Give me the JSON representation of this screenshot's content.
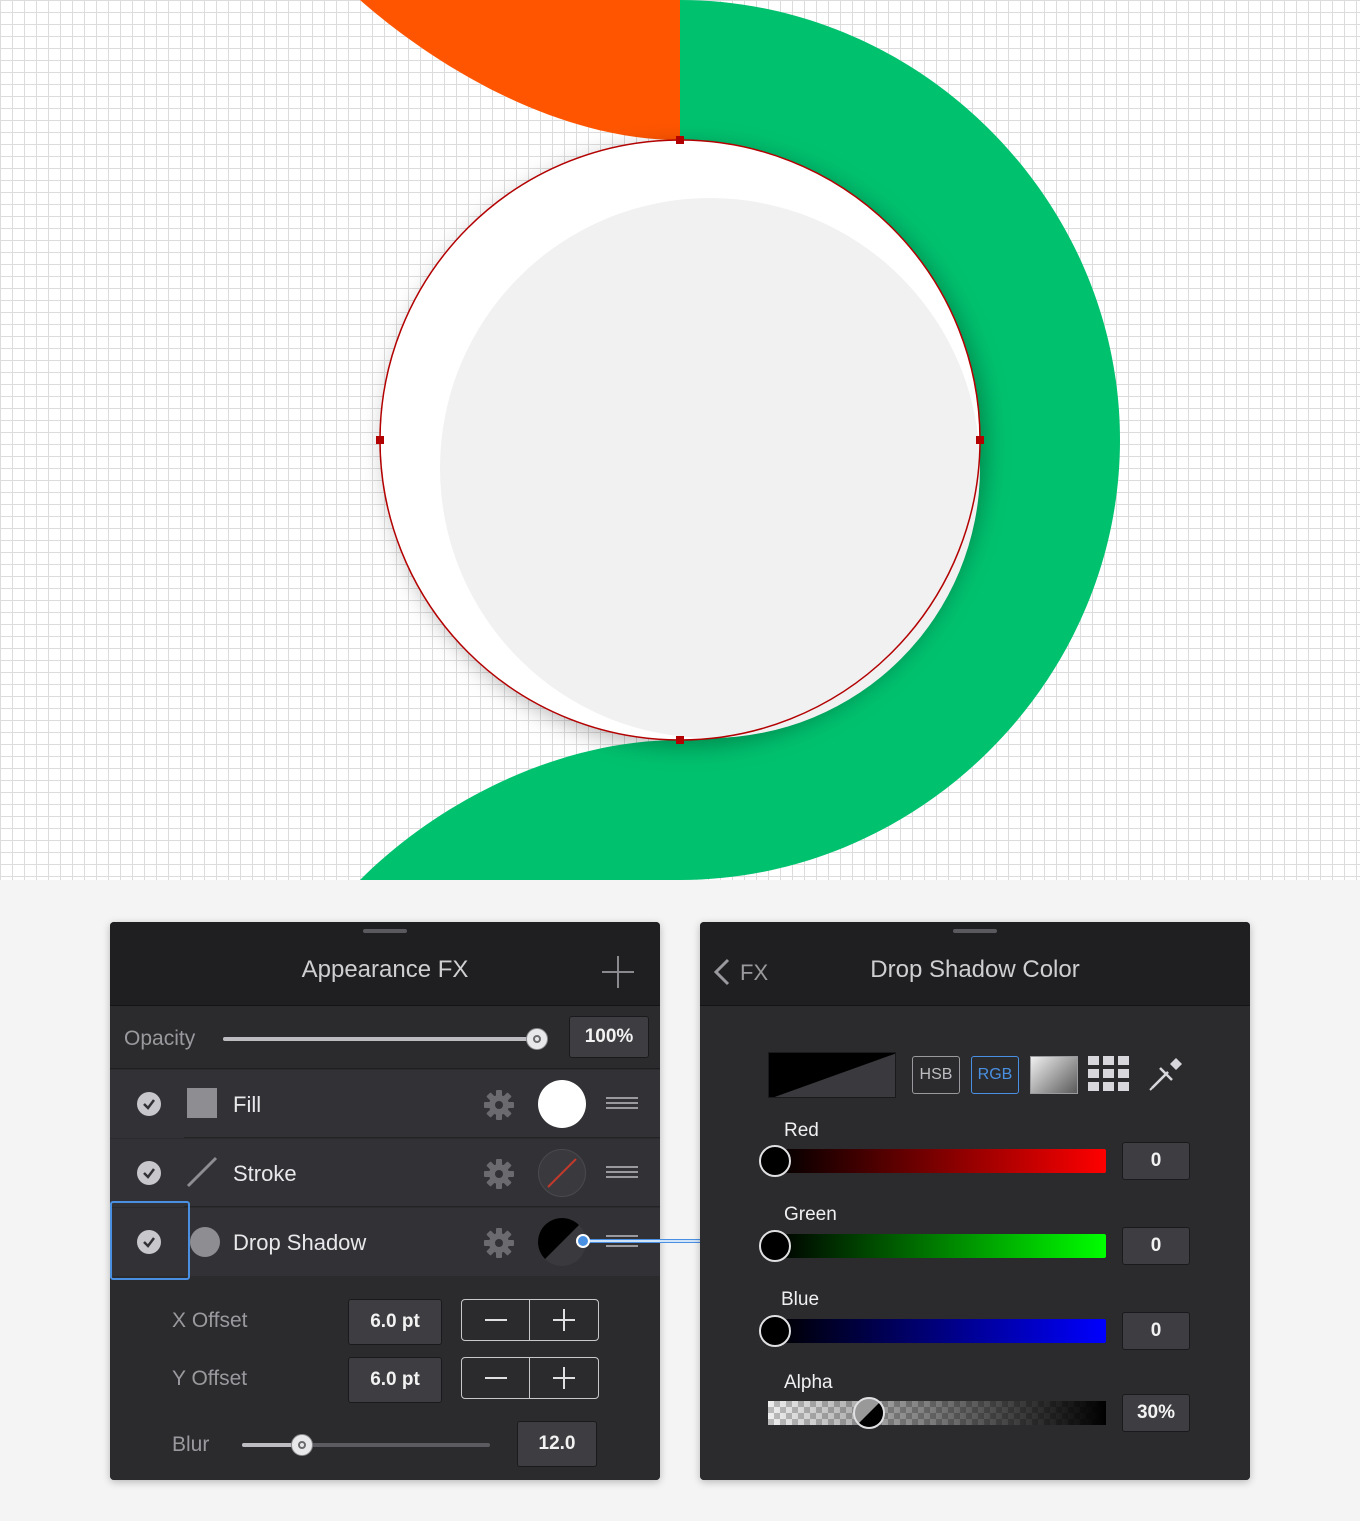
{
  "canvas": {
    "colors": {
      "orange": "#ff5500",
      "green": "#00c16e",
      "selection_stroke": "#b30000",
      "inner_fill": "#f1f1f1"
    }
  },
  "appearance_panel": {
    "title": "Appearance FX",
    "add_icon": "plus-icon",
    "opacity": {
      "label": "Opacity",
      "value_text": "100%",
      "level": 1.0
    },
    "rows": [
      {
        "label": "Fill",
        "enabled": true,
        "icon": "square-icon",
        "swatch_color": "#ffffff"
      },
      {
        "label": "Stroke",
        "enabled": true,
        "icon": "line-icon",
        "swatch_color": "none"
      },
      {
        "label": "Drop Shadow",
        "enabled": true,
        "icon": "circle-icon",
        "swatch_color": "#000000"
      }
    ],
    "x_offset": {
      "label": "X Offset",
      "value": "6.0 pt"
    },
    "y_offset": {
      "label": "Y Offset",
      "value": "6.0 pt"
    },
    "blur": {
      "label": "Blur",
      "value": "12.0",
      "level": 0.24
    }
  },
  "color_panel": {
    "back_label": "FX",
    "title": "Drop Shadow Color",
    "mode_hsb": "HSB",
    "mode_rgb": "RGB",
    "active_mode": "RGB",
    "channels": [
      {
        "label": "Red",
        "value": "0",
        "color": "#ff0000"
      },
      {
        "label": "Green",
        "value": "0",
        "color": "#00ff00"
      },
      {
        "label": "Blue",
        "value": "0",
        "color": "#0000ff"
      }
    ],
    "alpha": {
      "label": "Alpha",
      "value": "30%",
      "level": 0.3
    }
  }
}
